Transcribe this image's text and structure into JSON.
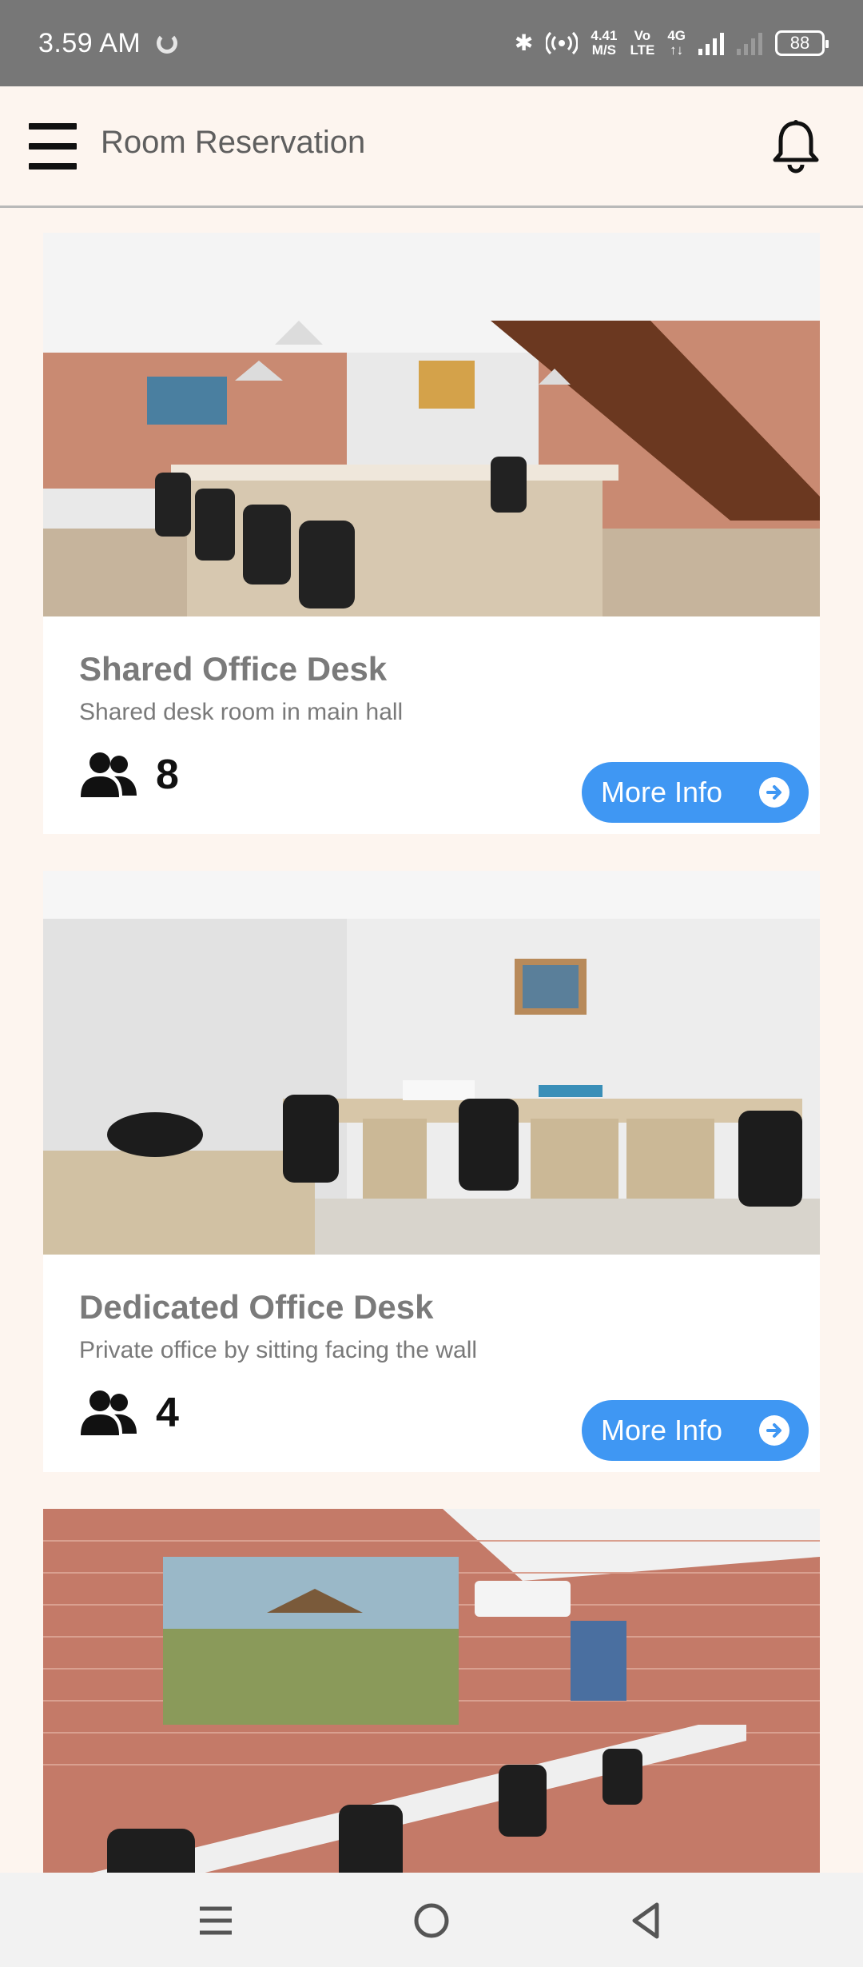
{
  "status_bar": {
    "time": "3.59 AM",
    "network_speed_value": "4.41",
    "network_speed_unit": "M/S",
    "volte_top": "Vo",
    "volte_bottom": "LTE",
    "net_type": "4G",
    "battery": "88"
  },
  "app_bar": {
    "title": "Room Reservation",
    "menu_icon": "hamburger-menu-icon",
    "notification_icon": "bell-icon"
  },
  "rooms": [
    {
      "name": "Shared Office Desk",
      "description": "Shared desk room in main hall",
      "capacity": "8",
      "button_label": "More Info",
      "image": "office-hall-photo"
    },
    {
      "name": "Dedicated Office Desk",
      "description": "Private office by sitting facing the wall",
      "capacity": "4",
      "button_label": "More Info",
      "image": "private-office-photo"
    },
    {
      "name": "",
      "description": "",
      "capacity": "",
      "button_label": "",
      "image": "brick-wall-office-photo"
    }
  ],
  "nav_bar": {
    "buttons": [
      "menu-nav-icon",
      "home-nav-icon",
      "back-nav-icon"
    ]
  },
  "colors": {
    "accent": "#3f97f3",
    "status_bar": "#777777",
    "background": "#fdf5ef"
  }
}
